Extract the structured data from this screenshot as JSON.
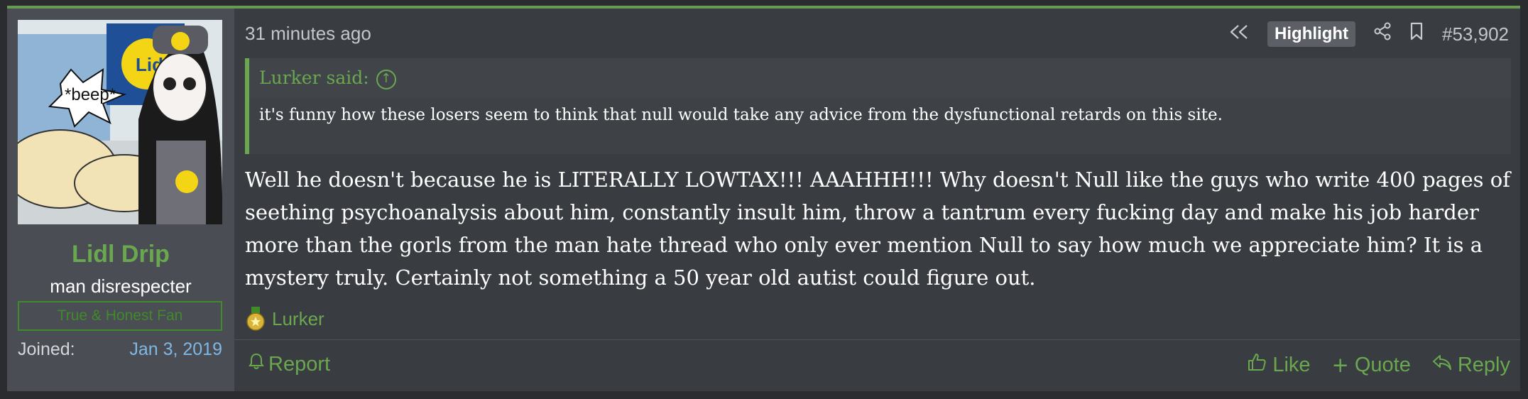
{
  "user": {
    "avatar_caption": "*beep*",
    "name": "Lidl Drip",
    "title": "man disrespecter",
    "banner": "True & Honest Fan",
    "joined_label": "Joined:",
    "joined_value": "Jan 3, 2019"
  },
  "post": {
    "date": "31 minutes ago",
    "highlight_label": "Highlight",
    "number": "#53,902",
    "icons": [
      "rewind-icon",
      "share-icon",
      "bookmark-icon"
    ],
    "quote": {
      "author": "Lurker said:",
      "text": "it's funny how these losers seem to think that null would take any advice from the dysfunctional retards on this site."
    },
    "message": "Well he doesn't because he is LITERALLY LOWTAX!!! AAAHHH!!! Why doesn't Null like the guys who write 400 pages of seething psychoanalysis about him, constantly insult him, throw a tantrum every fucking day and make his job harder more than the gorls from the man hate thread who only ever mention Null to say how much we appreciate him? It is a mystery truly. Certainly not something a 50 year old autist could figure out.",
    "reactions_label": "Lurker"
  },
  "footer": {
    "report": "Report",
    "like": "Like",
    "quote": "Quote",
    "reply": "Reply"
  },
  "colors": {
    "accent": "#6aa84f",
    "link_blue": "#7fb7e5",
    "background": "#393c41"
  }
}
